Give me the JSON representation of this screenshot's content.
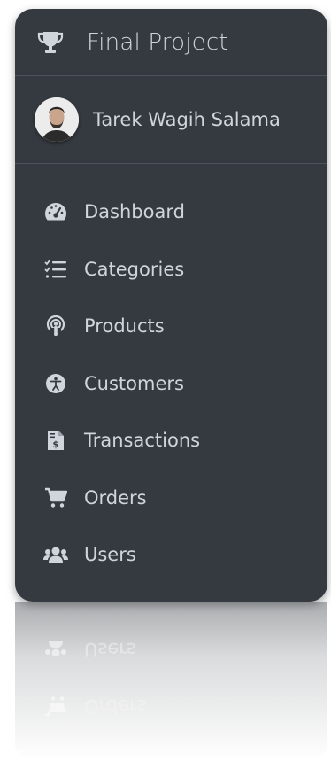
{
  "brand": {
    "title": "Final Project",
    "icon": "trophy-icon"
  },
  "user": {
    "name": "Tarek Wagih Salama"
  },
  "nav": [
    {
      "label": "Dashboard",
      "icon": "tachometer-icon"
    },
    {
      "label": "Categories",
      "icon": "list-check-icon"
    },
    {
      "label": "Products",
      "icon": "podcast-icon"
    },
    {
      "label": "Customers",
      "icon": "accessibility-icon"
    },
    {
      "label": "Transactions",
      "icon": "invoice-dollar-icon"
    },
    {
      "label": "Orders",
      "icon": "shopping-cart-icon"
    },
    {
      "label": "Users",
      "icon": "users-icon"
    }
  ],
  "colors": {
    "sidebar_bg": "#343a40",
    "text": "#d0d4db",
    "divider": "#4b545c"
  }
}
